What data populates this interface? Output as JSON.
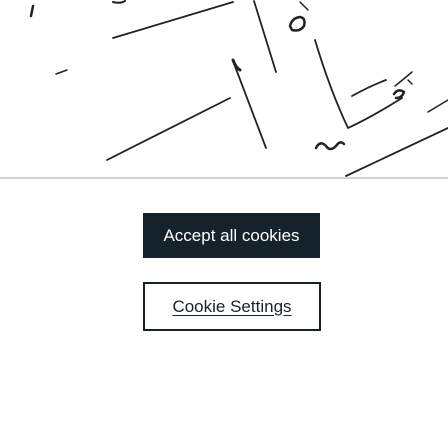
{
  "cookie_banner": {
    "accept_all_label": "Accept all cookies",
    "settings_label": "Cookie Settings"
  },
  "colors": {
    "accept_background": "#15222c",
    "accept_text": "#ffffff",
    "settings_border": "#15222c",
    "settings_text": "#15222c"
  }
}
